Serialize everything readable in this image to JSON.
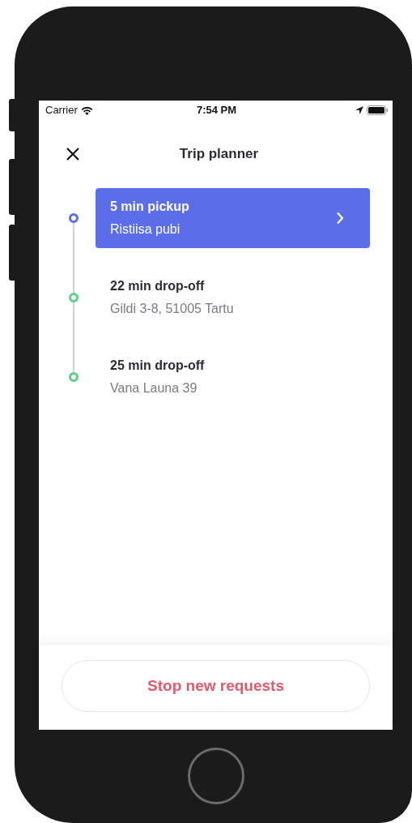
{
  "status_bar": {
    "carrier": "Carrier",
    "time": "7:54 PM"
  },
  "header": {
    "title": "Trip planner"
  },
  "stops": [
    {
      "title": "5 min pickup",
      "address": "Ristiisa pubi",
      "color": "#5b6ee8",
      "selected": true
    },
    {
      "title": "22 min drop-off",
      "address": "Gildi 3-8, 51005 Tartu",
      "color": "#5ccf86",
      "selected": false
    },
    {
      "title": "25 min drop-off",
      "address": "Vana Launa 39",
      "color": "#5ccf86",
      "selected": false
    }
  ],
  "footer": {
    "button": "Stop new requests"
  }
}
